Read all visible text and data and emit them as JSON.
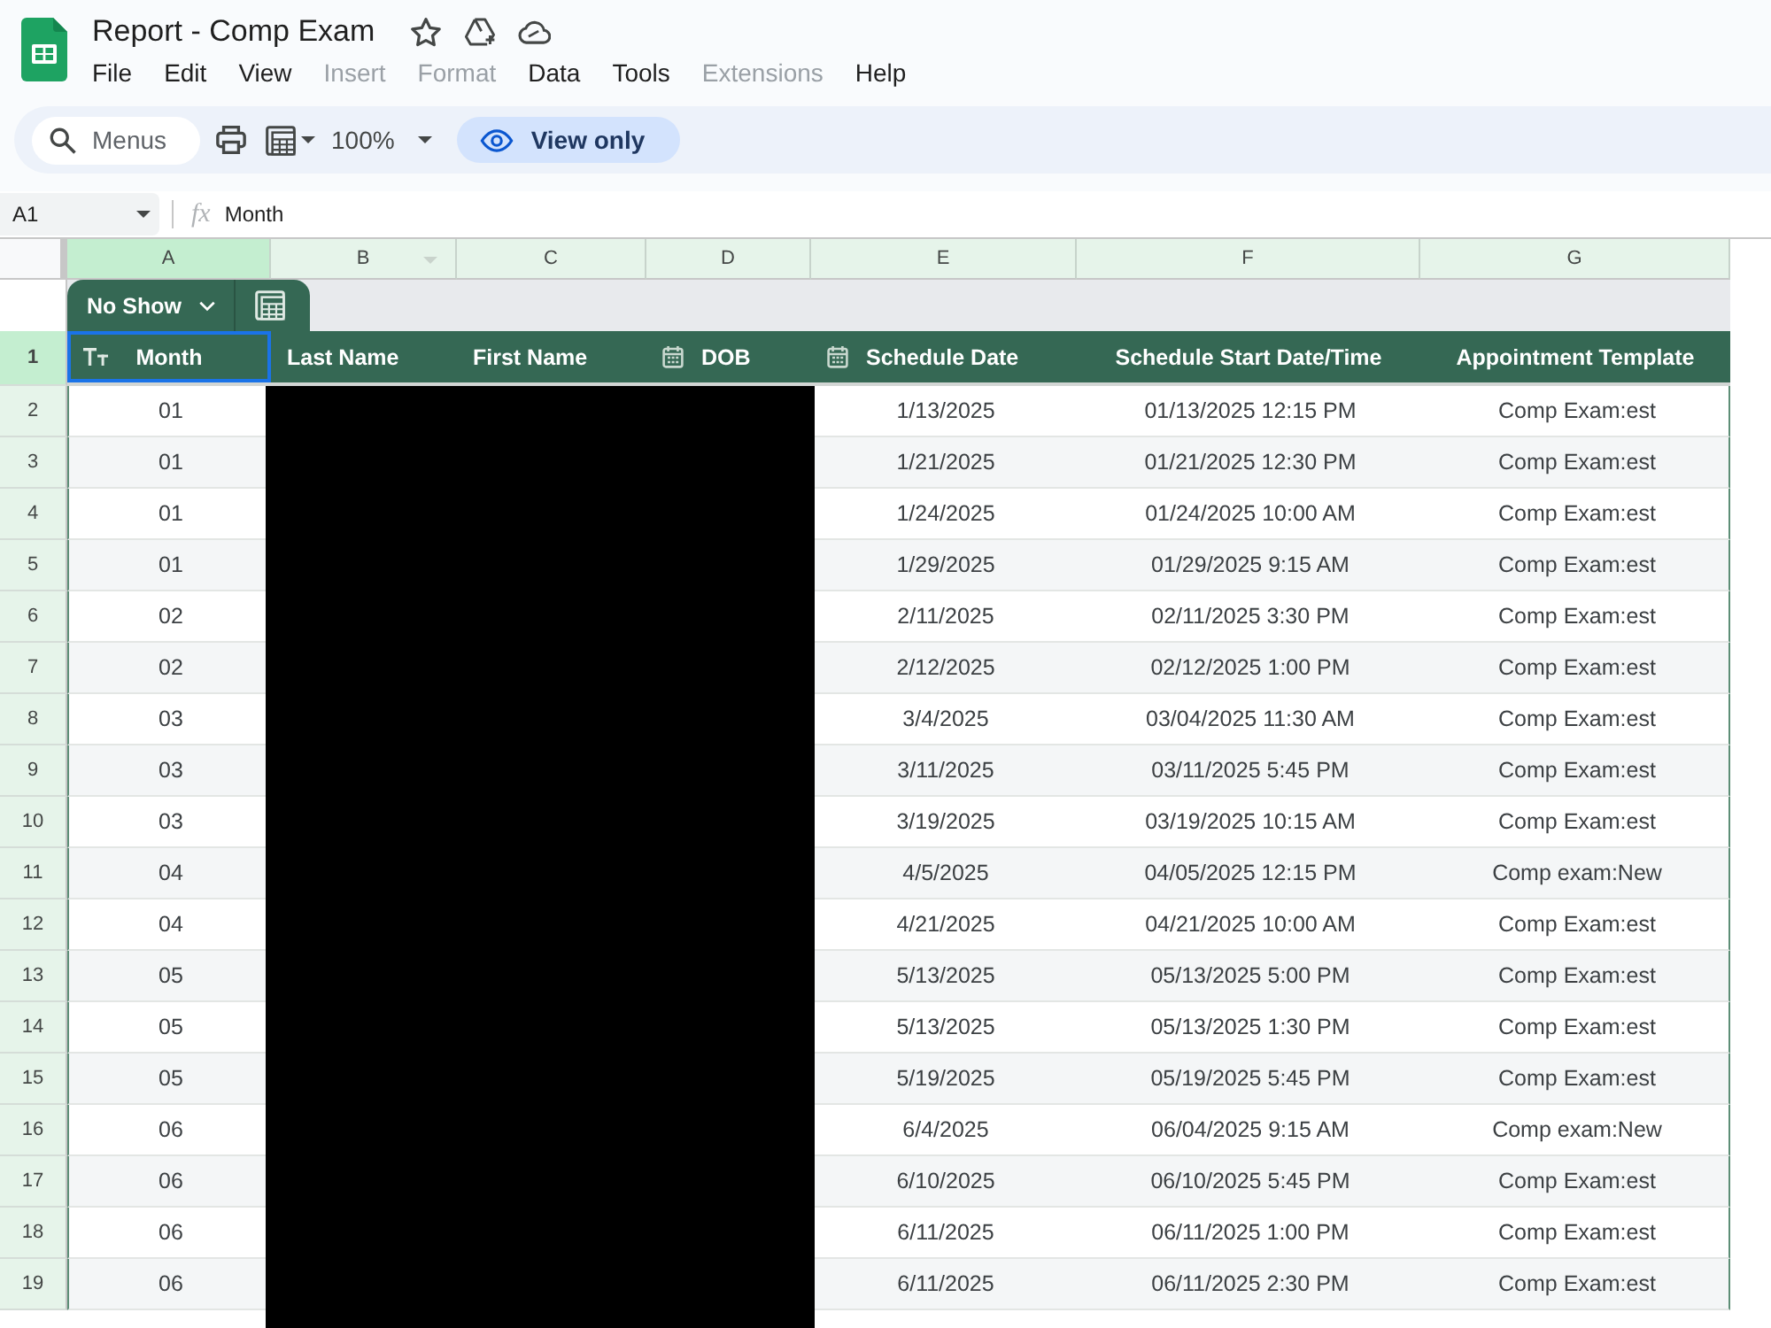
{
  "document": {
    "title": "Report - Comp Exam"
  },
  "menu": [
    {
      "label": "File",
      "disabled": false
    },
    {
      "label": "Edit",
      "disabled": false
    },
    {
      "label": "View",
      "disabled": false
    },
    {
      "label": "Insert",
      "disabled": true
    },
    {
      "label": "Format",
      "disabled": true
    },
    {
      "label": "Data",
      "disabled": false
    },
    {
      "label": "Tools",
      "disabled": false
    },
    {
      "label": "Extensions",
      "disabled": true
    },
    {
      "label": "Help",
      "disabled": false
    }
  ],
  "toolbar": {
    "search": {
      "placeholder": "Menus"
    },
    "zoom": "100%",
    "mode_button": "View only"
  },
  "formula_bar": {
    "cell_reference": "A1",
    "function_label": "fx",
    "value": "Month"
  },
  "sheet": {
    "columns": [
      {
        "letter": "A",
        "selected": true,
        "menu_caret": false
      },
      {
        "letter": "B",
        "selected": false,
        "menu_caret": true
      },
      {
        "letter": "C",
        "selected": false,
        "menu_caret": false
      },
      {
        "letter": "D",
        "selected": false,
        "menu_caret": false
      },
      {
        "letter": "E",
        "selected": false,
        "menu_caret": false
      },
      {
        "letter": "F",
        "selected": false,
        "menu_caret": false
      },
      {
        "letter": "G",
        "selected": false,
        "menu_caret": false
      }
    ],
    "table": {
      "name": "No Show",
      "header": {
        "row_number": "1",
        "selected": true,
        "cells": [
          {
            "label": "Month",
            "kind": "text",
            "selected": true
          },
          {
            "label": "Last Name",
            "kind": "plain",
            "selected": false
          },
          {
            "label": "First Name",
            "kind": "plain",
            "selected": false
          },
          {
            "label": "DOB",
            "kind": "date",
            "selected": false
          },
          {
            "label": "Schedule Date",
            "kind": "date",
            "selected": false
          },
          {
            "label": "Schedule Start Date/Time",
            "kind": "plain",
            "selected": false
          },
          {
            "label": "Appointment Template",
            "kind": "plain",
            "selected": false
          }
        ]
      },
      "rows": [
        {
          "row_number": "2",
          "selected": false,
          "month": "01",
          "schedule_date": "1/13/2025",
          "schedule_start": "01/13/2025 12:15 PM",
          "appointment_template": "Comp Exam:est"
        },
        {
          "row_number": "3",
          "selected": false,
          "month": "01",
          "schedule_date": "1/21/2025",
          "schedule_start": "01/21/2025 12:30 PM",
          "appointment_template": "Comp Exam:est"
        },
        {
          "row_number": "4",
          "selected": false,
          "month": "01",
          "schedule_date": "1/24/2025",
          "schedule_start": "01/24/2025 10:00 AM",
          "appointment_template": "Comp Exam:est"
        },
        {
          "row_number": "5",
          "selected": false,
          "month": "01",
          "schedule_date": "1/29/2025",
          "schedule_start": "01/29/2025 9:15 AM",
          "appointment_template": "Comp Exam:est"
        },
        {
          "row_number": "6",
          "selected": false,
          "month": "02",
          "schedule_date": "2/11/2025",
          "schedule_start": "02/11/2025 3:30 PM",
          "appointment_template": "Comp Exam:est"
        },
        {
          "row_number": "7",
          "selected": false,
          "month": "02",
          "schedule_date": "2/12/2025",
          "schedule_start": "02/12/2025 1:00 PM",
          "appointment_template": "Comp Exam:est"
        },
        {
          "row_number": "8",
          "selected": false,
          "month": "03",
          "schedule_date": "3/4/2025",
          "schedule_start": "03/04/2025 11:30 AM",
          "appointment_template": "Comp Exam:est"
        },
        {
          "row_number": "9",
          "selected": false,
          "month": "03",
          "schedule_date": "3/11/2025",
          "schedule_start": "03/11/2025 5:45 PM",
          "appointment_template": "Comp Exam:est"
        },
        {
          "row_number": "10",
          "selected": false,
          "month": "03",
          "schedule_date": "3/19/2025",
          "schedule_start": "03/19/2025 10:15 AM",
          "appointment_template": "Comp Exam:est"
        },
        {
          "row_number": "11",
          "selected": false,
          "month": "04",
          "schedule_date": "4/5/2025",
          "schedule_start": "04/05/2025 12:15 PM",
          "appointment_template": "Comp exam:New"
        },
        {
          "row_number": "12",
          "selected": false,
          "month": "04",
          "schedule_date": "4/21/2025",
          "schedule_start": "04/21/2025 10:00 AM",
          "appointment_template": "Comp Exam:est"
        },
        {
          "row_number": "13",
          "selected": false,
          "month": "05",
          "schedule_date": "5/13/2025",
          "schedule_start": "05/13/2025 5:00 PM",
          "appointment_template": "Comp Exam:est"
        },
        {
          "row_number": "14",
          "selected": false,
          "month": "05",
          "schedule_date": "5/13/2025",
          "schedule_start": "05/13/2025 1:30 PM",
          "appointment_template": "Comp Exam:est"
        },
        {
          "row_number": "15",
          "selected": false,
          "month": "05",
          "schedule_date": "5/19/2025",
          "schedule_start": "05/19/2025 5:45 PM",
          "appointment_template": "Comp Exam:est"
        },
        {
          "row_number": "16",
          "selected": false,
          "month": "06",
          "schedule_date": "6/4/2025",
          "schedule_start": "06/04/2025 9:15 AM",
          "appointment_template": "Comp exam:New"
        },
        {
          "row_number": "17",
          "selected": false,
          "month": "06",
          "schedule_date": "6/10/2025",
          "schedule_start": "06/10/2025 5:45 PM",
          "appointment_template": "Comp Exam:est"
        },
        {
          "row_number": "18",
          "selected": false,
          "month": "06",
          "schedule_date": "6/11/2025",
          "schedule_start": "06/11/2025 1:00 PM",
          "appointment_template": "Comp Exam:est"
        },
        {
          "row_number": "19",
          "selected": false,
          "month": "06",
          "schedule_date": "6/11/2025",
          "schedule_start": "06/11/2025 2:30 PM",
          "appointment_template": "Comp Exam:est"
        }
      ]
    }
  }
}
